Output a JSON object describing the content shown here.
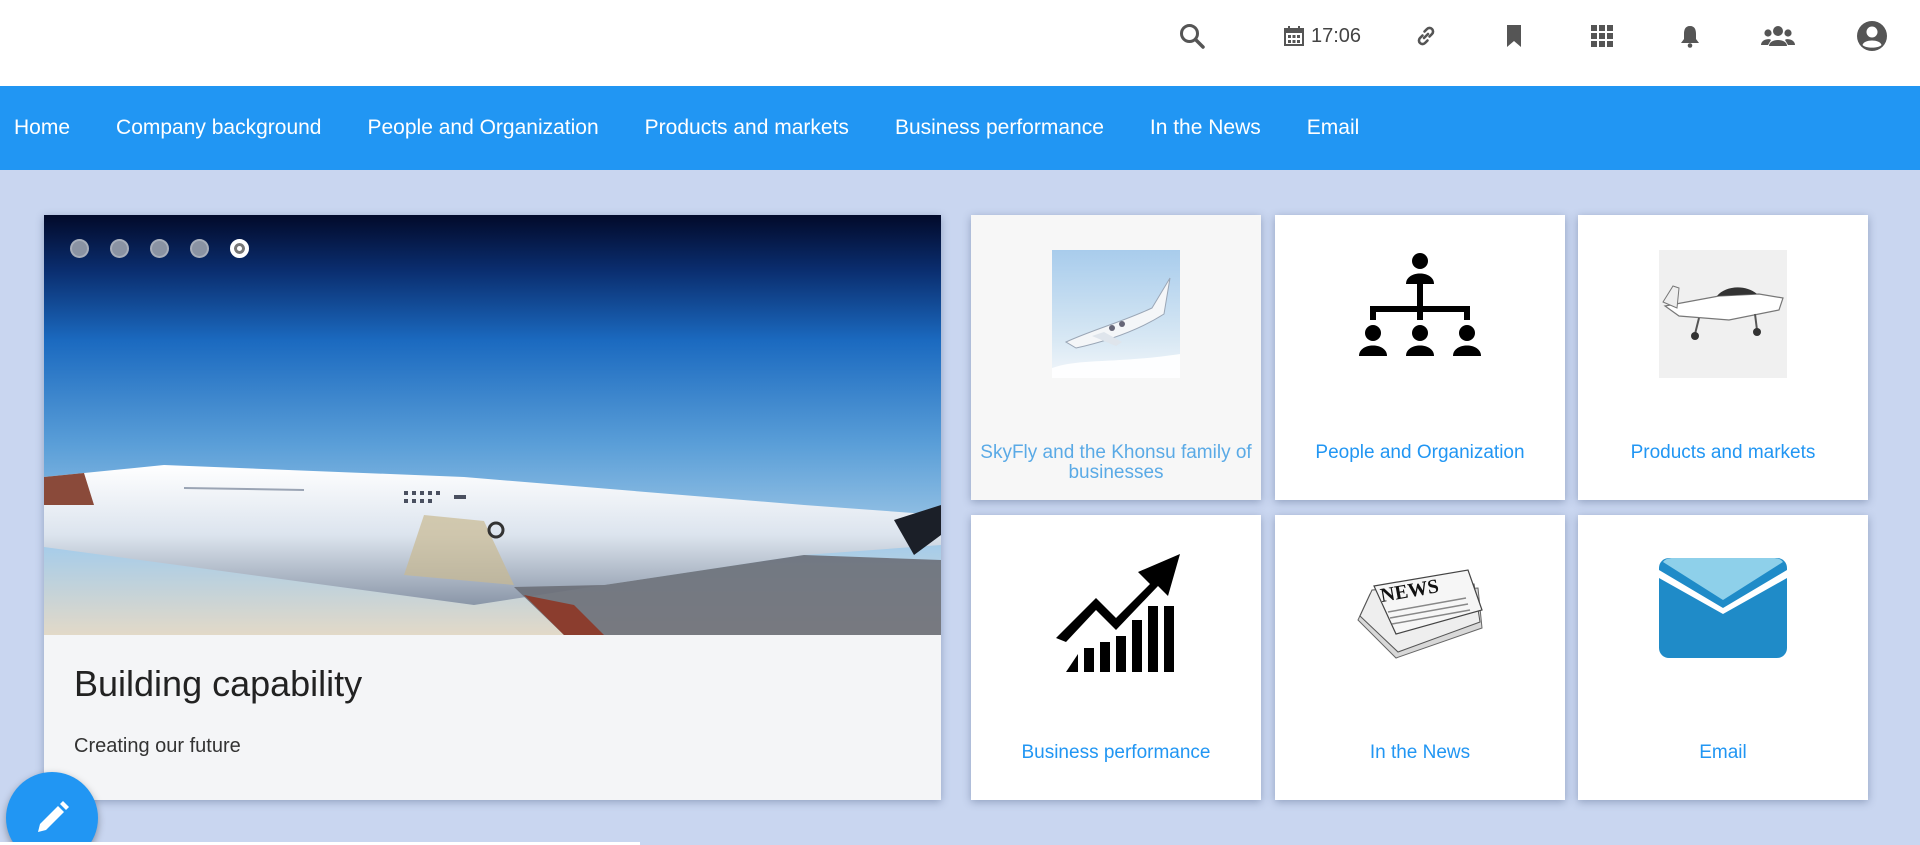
{
  "topbar": {
    "clock": "17:06",
    "icons": [
      "search-icon",
      "calendar-icon",
      "link-icon",
      "bookmark-icon",
      "apps-grid-icon",
      "bell-icon",
      "people-icon",
      "account-icon"
    ]
  },
  "nav": {
    "items": [
      "Home",
      "Company background",
      "People and Organization",
      "Products and markets",
      "Business performance",
      "In the News",
      "Email"
    ]
  },
  "carousel": {
    "slide_count": 5,
    "active_slide": 5,
    "title": "Building capability",
    "subtitle": "Creating our future"
  },
  "tiles": [
    {
      "label": "SkyFly and the Khonsu family of businesses",
      "icon": "jet-photo-icon"
    },
    {
      "label": "People and Organization",
      "icon": "org-chart-icon"
    },
    {
      "label": "Products and markets",
      "icon": "small-plane-photo-icon"
    },
    {
      "label": "Business performance",
      "icon": "growth-chart-icon"
    },
    {
      "label": "In the News",
      "icon": "newspaper-icon"
    },
    {
      "label": "Email",
      "icon": "envelope-icon"
    }
  ],
  "colors": {
    "primary": "#2196f3",
    "background": "#c9d6f0"
  }
}
